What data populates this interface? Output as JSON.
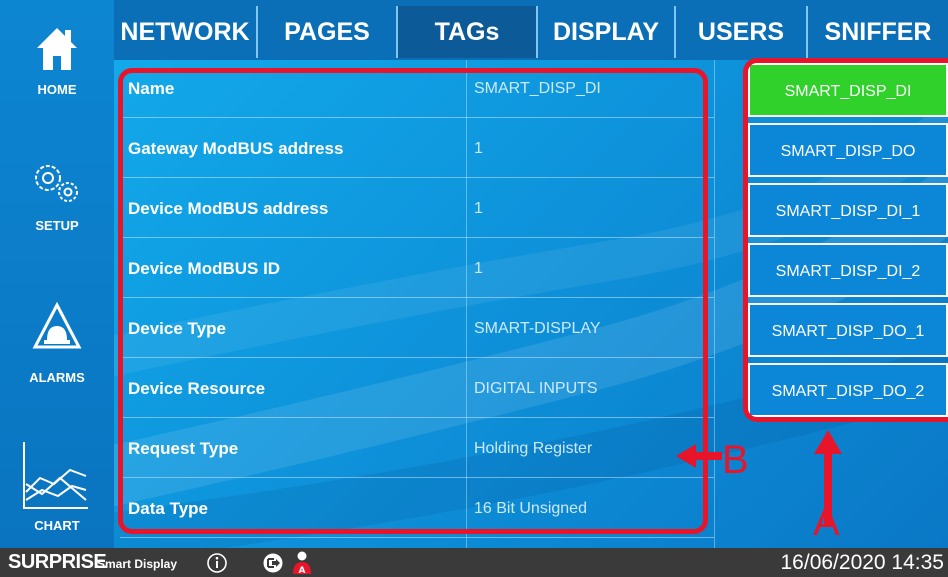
{
  "sidebar": {
    "items": [
      {
        "label": "HOME",
        "icon": "home-icon"
      },
      {
        "label": "SETUP",
        "icon": "gears-icon"
      },
      {
        "label": "ALARMS",
        "icon": "alarm-light-icon"
      },
      {
        "label": "CHART",
        "icon": "chart-icon"
      }
    ]
  },
  "tabs": [
    {
      "label": "NETWORK"
    },
    {
      "label": "PAGES"
    },
    {
      "label": "TAGs",
      "active": true
    },
    {
      "label": "DISPLAY"
    },
    {
      "label": "USERS"
    },
    {
      "label": "SNIFFER"
    }
  ],
  "properties": [
    {
      "label": "Name",
      "value": "SMART_DISP_DI"
    },
    {
      "label": "Gateway ModBUS address",
      "value": "1"
    },
    {
      "label": "Device ModBUS address",
      "value": "1"
    },
    {
      "label": "Device ModBUS ID",
      "value": "1"
    },
    {
      "label": "Device Type",
      "value": "SMART-DISPLAY"
    },
    {
      "label": "Device Resource",
      "value": "DIGITAL INPUTS"
    },
    {
      "label": "Request Type",
      "value": "Holding Register"
    },
    {
      "label": "Data Type",
      "value": "16 Bit Unsigned"
    }
  ],
  "tag_list": [
    {
      "label": "SMART_DISP_DI",
      "selected": true
    },
    {
      "label": "SMART_DISP_DO"
    },
    {
      "label": "SMART_DISP_DI_1"
    },
    {
      "label": "SMART_DISP_DI_2"
    },
    {
      "label": "SMART_DISP_DO_1"
    },
    {
      "label": "SMART_DISP_DO_2"
    }
  ],
  "annotations": {
    "a": "A",
    "b": "B"
  },
  "status_bar": {
    "brand": "SURPRISE",
    "brand_sub": "Smart Display",
    "datetime": "16/06/2020 14:35"
  },
  "colors": {
    "accent_red": "#e8152a",
    "selected_green": "#2fd12a",
    "panel_blue": "#0e93db"
  }
}
